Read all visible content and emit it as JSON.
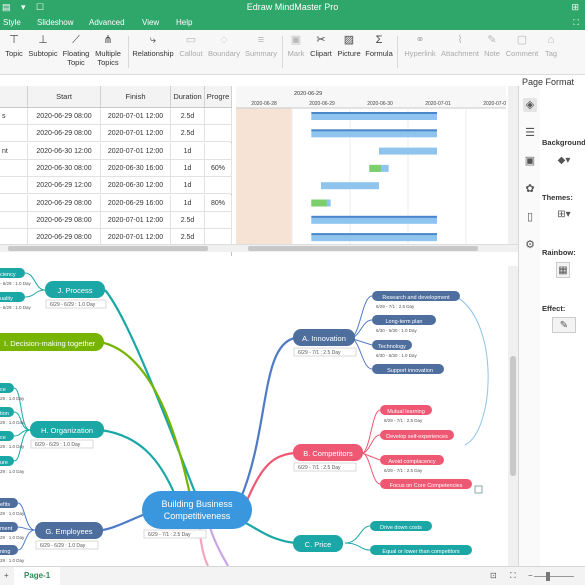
{
  "window": {
    "title": "Edraw MindMaster Pro"
  },
  "menu": [
    "Style",
    "Slideshow",
    "Advanced",
    "View",
    "Help"
  ],
  "ribbon": {
    "topic": "Topic",
    "subtopic": "Subtopic",
    "floating": [
      "Floating",
      "Topic"
    ],
    "multiple": [
      "Multiple",
      "Topics"
    ],
    "relationship": "Relationship",
    "callout": "Callout",
    "boundary": "Boundary",
    "summary": "Summary",
    "mark": "Mark",
    "clipart": "Clipart",
    "picture": "Picture",
    "formula": "Formula",
    "hyperlink": "Hyperlink",
    "attachment": "Attachment",
    "note": "Note",
    "comment": "Comment",
    "tag": "Tag"
  },
  "gantt": {
    "headers": [
      "Start",
      "Finish",
      "Duration",
      "Progre"
    ],
    "rows": [
      {
        "name": "s",
        "start": "2020-06-29 08:00",
        "finish": "2020-07-01 12:00",
        "duration": "2.5d",
        "progress": ""
      },
      {
        "name": "",
        "start": "2020-06-29 08:00",
        "finish": "2020-07-01 12:00",
        "duration": "2.5d",
        "progress": ""
      },
      {
        "name": "nt",
        "start": "2020-06-30 12:00",
        "finish": "2020-07-01 12:00",
        "duration": "1d",
        "progress": ""
      },
      {
        "name": "",
        "start": "2020-06-30 08:00",
        "finish": "2020-06-30 16:00",
        "duration": "1d",
        "progress": "60%"
      },
      {
        "name": "",
        "start": "2020-06-29 12:00",
        "finish": "2020-06-30 12:00",
        "duration": "1d",
        "progress": ""
      },
      {
        "name": "",
        "start": "2020-06-29 08:00",
        "finish": "2020-06-29 16:00",
        "duration": "1d",
        "progress": "80%"
      },
      {
        "name": "",
        "start": "2020-06-29 08:00",
        "finish": "2020-07-01 12:00",
        "duration": "2.5d",
        "progress": ""
      },
      {
        "name": "",
        "start": "2020-06-29 08:00",
        "finish": "2020-07-01 12:00",
        "duration": "2.5d",
        "progress": ""
      }
    ],
    "week_label": "2020-06-29",
    "dates": [
      "2020-06-28",
      "2020-06-29",
      "2020-06-30",
      "2020-07-01",
      "2020-07-02"
    ],
    "colors": {
      "bar": "#8ec4ee",
      "progress": "#7ccf6a",
      "weekend": "#f6e3d6"
    }
  },
  "panel": {
    "title": "Page Format",
    "background": "Background",
    "themes": "Themes:",
    "rainbow": "Rainbow:",
    "effect": "Effect:"
  },
  "map": {
    "central": {
      "title": [
        "Building Business",
        "Competitiveness"
      ],
      "meta": "6/29 - 7/1 : 2.5 Day"
    },
    "innovation": {
      "title": "A. Innovation",
      "meta": "6/29 - 7/1 : 2.5 Day",
      "children": [
        "Research and development",
        "Long-term plan",
        "Technology",
        "Support innovation"
      ],
      "metas": [
        "6/29 - 7/1 : 2.5 Day",
        "6/30 - 6/30 : 1.0 Day",
        "6/30 - 6/30 : 1.0 Day"
      ]
    },
    "competitors": {
      "title": "B. Competitors",
      "meta": "6/29 - 7/1 : 2.5 Day",
      "children": [
        "Mutual learning",
        "Develop self-experiences",
        "Avoid complacency",
        "Focus on Core Competencies"
      ],
      "metas": [
        "6/29 - 7/1 : 2.5 Day",
        "6/29 - 7/1 : 2.5 Day"
      ]
    },
    "price": {
      "title": "C. Price",
      "children": [
        "Drive down costs",
        "Equal or lower than competitors"
      ]
    },
    "process": {
      "title": "J. Process",
      "meta": "6/29 - 6/29 : 1.0 Day",
      "children": [
        "ciency",
        "uality"
      ],
      "metas": [
        "- 6/29 : 1.0 Day",
        "- 6/29 : 1.0 Day"
      ]
    },
    "decision": {
      "title": "I. Decision-making together"
    },
    "organization": {
      "title": "H. Organization",
      "meta": "6/29 - 6/29 : 1.0 Day",
      "children": [
        "ce",
        "tion",
        "ce",
        "ure"
      ],
      "metas": [
        "29 : 1.0 Day",
        "29 : 1.0 Day",
        "29 : 1.0 Day",
        "29 : 1.0 Day"
      ]
    },
    "employees": {
      "title": "G. Employees",
      "meta": "6/29 - 6/29 : 1.0 Day",
      "children": [
        "efits",
        "ment",
        "ning"
      ],
      "metas": [
        "29 : 1.0 Day",
        "29 : 1.0 Day",
        "29 : 1.0 Day"
      ]
    }
  },
  "status": {
    "page_tab": "Page-1",
    "add_page": "+"
  }
}
